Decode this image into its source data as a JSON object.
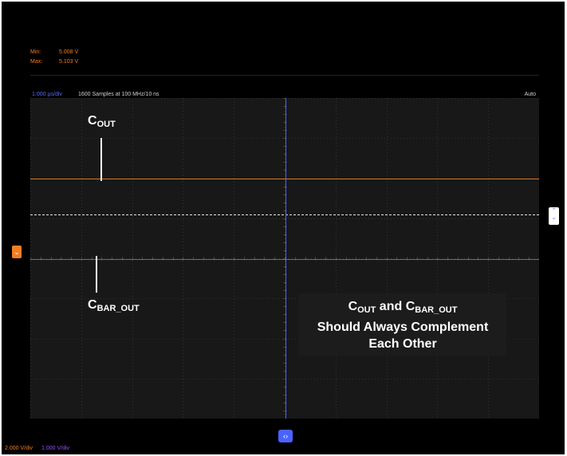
{
  "measurements": {
    "min_label": "Min:",
    "min_value": "5.008 V",
    "max_label": "Max:",
    "max_value": "5.103 V"
  },
  "header": {
    "timebase": "1.000 µs/div",
    "samples": "1600 Samples at 100 MHz/10 ns",
    "trigger_mode": "Auto"
  },
  "annotations": {
    "cout_main": "C",
    "cout_sub": "OUT",
    "cbar_main": "C",
    "cbar_sub": "BAR_OUT",
    "note_c1_main": "C",
    "note_c1_sub": "OUT",
    "note_and": " and ",
    "note_c2_main": "C",
    "note_c2_sub": "BAR_OUT",
    "note_line2": "Should Always Complement",
    "note_line3": "Each Other"
  },
  "channels": [
    {
      "scale": "2.000 V/div",
      "color": "#f07f25"
    },
    {
      "scale": "1.000 V/div",
      "color": "#9a4dff"
    }
  ],
  "icons": {
    "channel_marker": "chevron-down-icon",
    "trigger_handle": "updown-chevrons-icon",
    "horizontal_handle": "leftright-chevrons-icon"
  },
  "colors": {
    "background": "#000000",
    "plot": "#181818",
    "ch1": "#f07f25",
    "ch2": "#9a4dff",
    "cursor": "#4a63ff"
  }
}
